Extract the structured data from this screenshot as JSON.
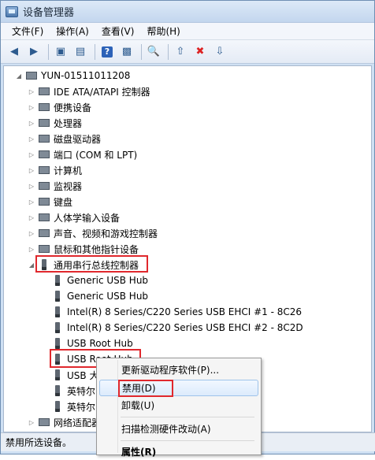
{
  "window": {
    "title": "设备管理器"
  },
  "menu": [
    "文件(F)",
    "操作(A)",
    "查看(V)",
    "帮助(H)"
  ],
  "toolbar": {
    "buttons": [
      "back-icon",
      "forward-icon",
      "properties-icon",
      "show-hidden-icon",
      "help-icon",
      "view-icon",
      "scan-icon",
      "update-driver-icon",
      "disable-icon",
      "uninstall-icon"
    ],
    "help_glyph": "?"
  },
  "tree": {
    "root": "YUN-01511011208",
    "categories": [
      "IDE ATA/ATAPI 控制器",
      "便携设备",
      "处理器",
      "磁盘驱动器",
      "端口 (COM 和 LPT)",
      "计算机",
      "监视器",
      "键盘",
      "人体学输入设备",
      "声音、视频和游戏控制器",
      "鼠标和其他指针设备",
      "通用串行总线控制器"
    ],
    "usb_children": [
      "Generic USB Hub",
      "Generic USB Hub",
      "Intel(R) 8 Series/C220 Series USB EHCI #1 - 8C26",
      "Intel(R) 8 Series/C220 Series USB EHCI #2 - 8C2D",
      "USB Root Hub",
      "USB Root Hub",
      "USB 大",
      "英特尔",
      "英特尔"
    ],
    "after": "网络适配器"
  },
  "context_menu": {
    "items": [
      "更新驱动程序软件(P)...",
      "禁用(D)",
      "卸载(U)",
      "扫描检测硬件改动(A)",
      "属性(R)"
    ]
  },
  "status": "禁用所选设备。",
  "colors": {
    "highlight": "#e0282d",
    "menu_hover": "#dcebfc"
  }
}
